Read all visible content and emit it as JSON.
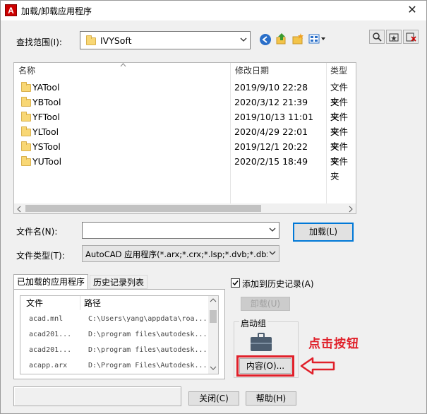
{
  "window": {
    "title": "加载/卸载应用程序",
    "close_glyph": "✕",
    "app_icon_letter": "A"
  },
  "toolbar": {
    "lookin_label": "查找范围(I):",
    "lookin_value": "IVYSoft",
    "icons": [
      "back-icon",
      "up-folder-icon",
      "new-folder-icon",
      "view-menu-icon"
    ],
    "right_icons": [
      "search-web-icon",
      "favorites-icon",
      "delete-icon"
    ]
  },
  "file_list": {
    "columns": {
      "name": "名称",
      "date": "修改日期",
      "type": "类型"
    },
    "rows": [
      {
        "name": "YATool",
        "date": "2019/9/10 22:28",
        "type": "文件夹"
      },
      {
        "name": "YBTool",
        "date": "2020/3/12 21:39",
        "type": "文件夹"
      },
      {
        "name": "YFTool",
        "date": "2019/10/13 11:01",
        "type": "文件夹"
      },
      {
        "name": "YLTool",
        "date": "2020/4/29 22:01",
        "type": "文件夹"
      },
      {
        "name": "YSTool",
        "date": "2019/12/1 20:22",
        "type": "文件夹"
      },
      {
        "name": "YUTool",
        "date": "2020/2/15 18:49",
        "type": "文件夹"
      }
    ]
  },
  "filename": {
    "label": "文件名(N):",
    "value": ""
  },
  "filetype": {
    "label": "文件类型(T):",
    "value": "AutoCAD 应用程序(*.arx;*.crx;*.lsp;*.dvb;*.dbx"
  },
  "buttons": {
    "load": "加载(L)",
    "unload": "卸载(U)",
    "contents": "内容(O)...",
    "close": "关闭(C)",
    "help": "帮助(H)"
  },
  "tabs": [
    {
      "label": "已加载的应用程序"
    },
    {
      "label": "历史记录列表"
    }
  ],
  "loaded_apps": {
    "columns": {
      "file": "文件",
      "path": "路径"
    },
    "rows": [
      {
        "file": "acad.mnl",
        "path": "C:\\Users\\yang\\appdata\\roa..."
      },
      {
        "file": "acad201...",
        "path": "D:\\program files\\autodesk..."
      },
      {
        "file": "acad201...",
        "path": "D:\\program files\\autodesk..."
      },
      {
        "file": "acapp.arx",
        "path": "D:\\Program Files\\Autodesk..."
      }
    ]
  },
  "history_checkbox": {
    "label": "添加到历史记录(A)",
    "checked": true
  },
  "startup_group": {
    "label": "启动组"
  },
  "annotation": {
    "text": "点击按钮",
    "color": "#e0202a"
  }
}
